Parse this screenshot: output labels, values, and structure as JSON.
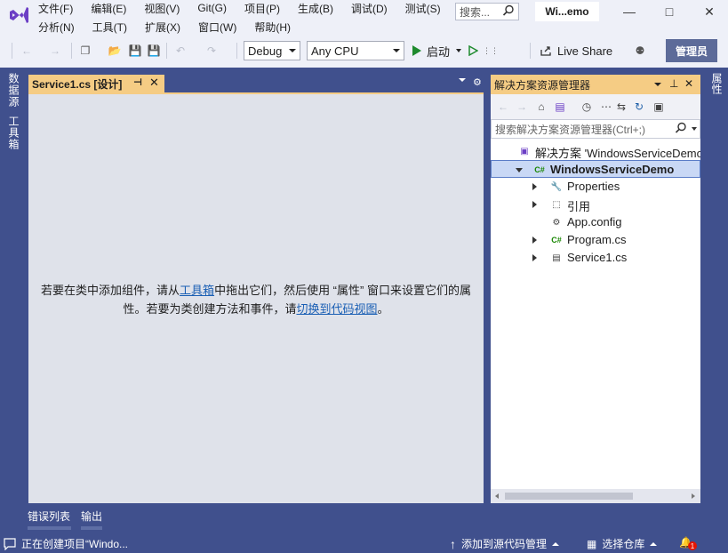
{
  "menu": {
    "row1": [
      "文件(F)",
      "编辑(E)",
      "视图(V)",
      "Git(G)",
      "项目(P)",
      "生成(B)",
      "调试(D)",
      "测试(S)"
    ],
    "row2": [
      "分析(N)",
      "工具(T)",
      "扩展(X)",
      "窗口(W)",
      "帮助(H)"
    ]
  },
  "title_search": {
    "placeholder": "搜索..."
  },
  "solution_title": "Wi...emo",
  "toolbar": {
    "configuration": "Debug",
    "platform": "Any CPU",
    "start_label": "启动",
    "live_share_label": "Live Share",
    "admin_label": "管理员"
  },
  "left_side_tabs": [
    "数据源",
    "工具箱"
  ],
  "right_side_tabs": [
    "属性"
  ],
  "document": {
    "tab_label": "Service1.cs [设计]",
    "message_part1": "若要在类中添加组件，请从",
    "message_link1": "工具箱",
    "message_part2": "中拖出它们，然后使用 “属性” 窗口来设置它们的属性。若要为类创建方法和事件，请",
    "message_link2": "切换到代码视图",
    "message_part3": "。"
  },
  "bottom_tabs": [
    "错误列表",
    "输出"
  ],
  "solution_explorer": {
    "title": "解决方案资源管理器",
    "search_placeholder": "搜索解决方案资源管理器(Ctrl+;)",
    "tree": [
      {
        "label": "解决方案 'WindowsServiceDemo' (1",
        "icon": "solution-icon",
        "level": 0,
        "arrow": "none"
      },
      {
        "label": "WindowsServiceDemo",
        "icon": "csharp-project-icon",
        "level": 1,
        "arrow": "down",
        "selected": true
      },
      {
        "label": "Properties",
        "icon": "wrench-icon",
        "level": 2,
        "arrow": "right"
      },
      {
        "label": "引用",
        "icon": "references-icon",
        "level": 2,
        "arrow": "right"
      },
      {
        "label": "App.config",
        "icon": "config-file-icon",
        "level": 2,
        "arrow": "none"
      },
      {
        "label": "Program.cs",
        "icon": "csharp-file-icon",
        "level": 2,
        "arrow": "right"
      },
      {
        "label": "Service1.cs",
        "icon": "service-file-icon",
        "level": 2,
        "arrow": "right"
      }
    ]
  },
  "statusbar": {
    "status_text": "正在创建项目“Windo...",
    "source_control": "添加到源代码管理",
    "repo_select": "选择仓库",
    "notification_count": "1"
  },
  "colors": {
    "frame": "#40508d",
    "active_tab": "#f5cc84",
    "selection": "#c9d8f5",
    "link": "#1a5fb4"
  }
}
